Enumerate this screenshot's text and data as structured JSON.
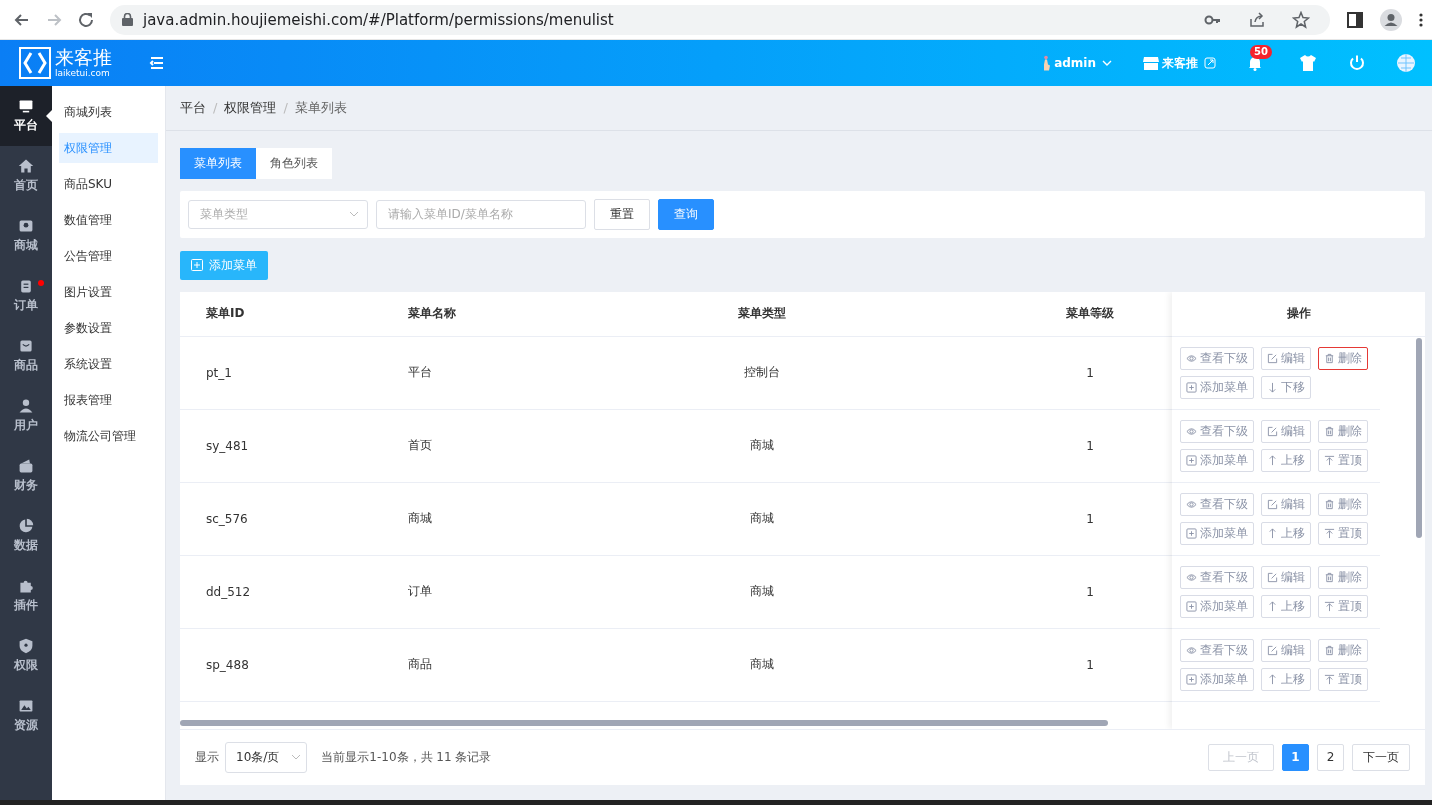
{
  "browser": {
    "url": "java.admin.houjiemeishi.com/#/Platform/permissions/menulist"
  },
  "header": {
    "logo_text": "来客推",
    "logo_subtext": "laiketui.com",
    "user": "admin",
    "shop": "来客推",
    "notifications": "50"
  },
  "rail": [
    {
      "label": "平台",
      "selected": true,
      "dot": false
    },
    {
      "label": "首页",
      "selected": false,
      "dot": false
    },
    {
      "label": "商城",
      "selected": false,
      "dot": false
    },
    {
      "label": "订单",
      "selected": false,
      "dot": true
    },
    {
      "label": "商品",
      "selected": false,
      "dot": false
    },
    {
      "label": "用户",
      "selected": false,
      "dot": false
    },
    {
      "label": "财务",
      "selected": false,
      "dot": false
    },
    {
      "label": "数据",
      "selected": false,
      "dot": false
    },
    {
      "label": "插件",
      "selected": false,
      "dot": false
    },
    {
      "label": "权限",
      "selected": false,
      "dot": false
    },
    {
      "label": "资源",
      "selected": false,
      "dot": false
    }
  ],
  "submenu": [
    {
      "label": "商城列表",
      "selected": false
    },
    {
      "label": "权限管理",
      "selected": true
    },
    {
      "label": "商品SKU",
      "selected": false
    },
    {
      "label": "数值管理",
      "selected": false
    },
    {
      "label": "公告管理",
      "selected": false
    },
    {
      "label": "图片设置",
      "selected": false
    },
    {
      "label": "参数设置",
      "selected": false
    },
    {
      "label": "系统设置",
      "selected": false
    },
    {
      "label": "报表管理",
      "selected": false
    },
    {
      "label": "物流公司管理",
      "selected": false
    }
  ],
  "breadcrumb": [
    "平台",
    "权限管理",
    "菜单列表"
  ],
  "breadcrumb_separator": "/",
  "tabs": [
    {
      "label": "菜单列表",
      "selected": true
    },
    {
      "label": "角色列表",
      "selected": false
    }
  ],
  "filters": {
    "type_placeholder": "菜单类型",
    "search_placeholder": "请输入菜单ID/菜单名称",
    "reset": "重置",
    "query": "查询"
  },
  "add_button": "添加菜单",
  "table": {
    "columns": [
      "菜单ID",
      "菜单名称",
      "菜单类型",
      "菜单等级",
      "操作"
    ],
    "rows": [
      {
        "id": "pt_1",
        "name": "平台",
        "type": "控制台",
        "level": "1",
        "actions": [
          {
            "kind": "view",
            "label": "查看下级",
            "highlighted": false
          },
          {
            "kind": "edit",
            "label": "编辑",
            "highlighted": false
          },
          {
            "kind": "delete",
            "label": "删除",
            "highlighted": true
          },
          {
            "kind": "add",
            "label": "添加菜单",
            "highlighted": false
          },
          {
            "kind": "down",
            "label": "下移",
            "highlighted": false
          }
        ]
      },
      {
        "id": "sy_481",
        "name": "首页",
        "type": "商城",
        "level": "1",
        "actions": [
          {
            "kind": "view",
            "label": "查看下级",
            "highlighted": false
          },
          {
            "kind": "edit",
            "label": "编辑",
            "highlighted": false
          },
          {
            "kind": "delete",
            "label": "删除",
            "highlighted": false
          },
          {
            "kind": "add",
            "label": "添加菜单",
            "highlighted": false
          },
          {
            "kind": "up",
            "label": "上移",
            "highlighted": false
          },
          {
            "kind": "top",
            "label": "置顶",
            "highlighted": false
          }
        ]
      },
      {
        "id": "sc_576",
        "name": "商城",
        "type": "商城",
        "level": "1",
        "actions": [
          {
            "kind": "view",
            "label": "查看下级",
            "highlighted": false
          },
          {
            "kind": "edit",
            "label": "编辑",
            "highlighted": false
          },
          {
            "kind": "delete",
            "label": "删除",
            "highlighted": false
          },
          {
            "kind": "add",
            "label": "添加菜单",
            "highlighted": false
          },
          {
            "kind": "up",
            "label": "上移",
            "highlighted": false
          },
          {
            "kind": "top",
            "label": "置顶",
            "highlighted": false
          }
        ]
      },
      {
        "id": "dd_512",
        "name": "订单",
        "type": "商城",
        "level": "1",
        "actions": [
          {
            "kind": "view",
            "label": "查看下级",
            "highlighted": false
          },
          {
            "kind": "edit",
            "label": "编辑",
            "highlighted": false
          },
          {
            "kind": "delete",
            "label": "删除",
            "highlighted": false
          },
          {
            "kind": "add",
            "label": "添加菜单",
            "highlighted": false
          },
          {
            "kind": "up",
            "label": "上移",
            "highlighted": false
          },
          {
            "kind": "top",
            "label": "置顶",
            "highlighted": false
          }
        ]
      },
      {
        "id": "sp_488",
        "name": "商品",
        "type": "商城",
        "level": "1",
        "actions": [
          {
            "kind": "view",
            "label": "查看下级",
            "highlighted": false
          },
          {
            "kind": "edit",
            "label": "编辑",
            "highlighted": false
          },
          {
            "kind": "delete",
            "label": "删除",
            "highlighted": false
          },
          {
            "kind": "add",
            "label": "添加菜单",
            "highlighted": false
          },
          {
            "kind": "up",
            "label": "上移",
            "highlighted": false
          },
          {
            "kind": "top",
            "label": "置顶",
            "highlighted": false
          }
        ]
      }
    ]
  },
  "pagination": {
    "show_label": "显示",
    "page_size": "10条/页",
    "summary": "当前显示1-10条，共 11 条记录",
    "prev": "上一页",
    "prev_disabled": true,
    "pages": [
      {
        "label": "1",
        "selected": true
      },
      {
        "label": "2",
        "selected": false
      }
    ],
    "next": "下一页"
  }
}
